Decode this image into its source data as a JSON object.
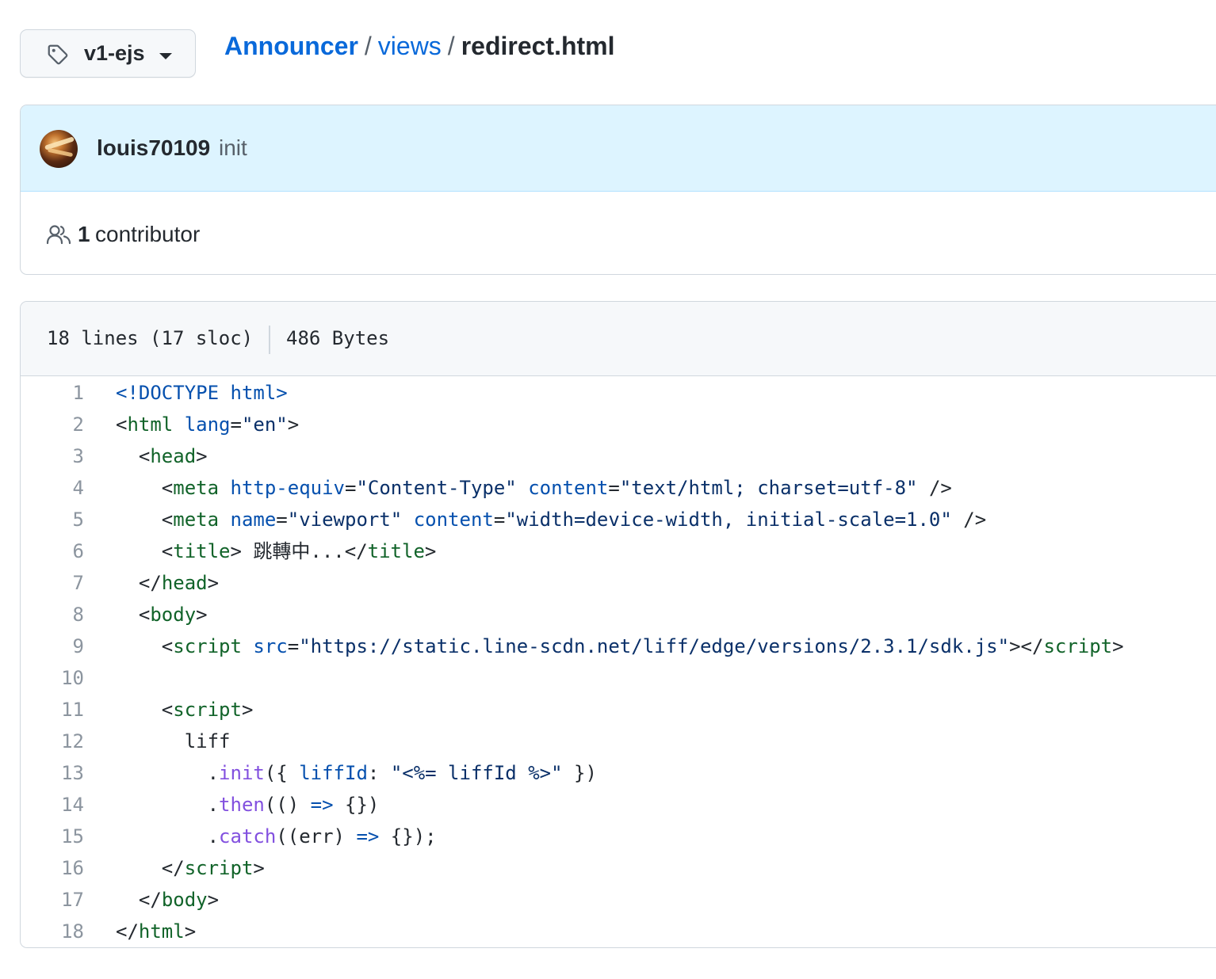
{
  "branch": {
    "name": "v1-ejs"
  },
  "breadcrumb": {
    "repo": "Announcer",
    "sep1": "/",
    "folder": "views",
    "sep2": "/",
    "file": "redirect.html"
  },
  "commit": {
    "author": "louis70109",
    "message": "init"
  },
  "contributors": {
    "count": "1",
    "label": "contributor"
  },
  "file_info": {
    "lines": "18 lines (17 sloc)",
    "size": "486 Bytes"
  },
  "code_lines": [
    {
      "num": "1"
    },
    {
      "num": "2"
    },
    {
      "num": "3"
    },
    {
      "num": "4"
    },
    {
      "num": "5"
    },
    {
      "num": "6"
    },
    {
      "num": "7"
    },
    {
      "num": "8"
    },
    {
      "num": "9"
    },
    {
      "num": "10"
    },
    {
      "num": "11"
    },
    {
      "num": "12"
    },
    {
      "num": "13"
    },
    {
      "num": "14"
    },
    {
      "num": "15"
    },
    {
      "num": "16"
    },
    {
      "num": "17"
    },
    {
      "num": "18"
    }
  ],
  "code": {
    "l1": {
      "doctype": "<!DOCTYPE html>"
    },
    "l2": {
      "open": "<",
      "tag": "html",
      "sp": " ",
      "attr": "lang",
      "eq": "=",
      "val": "\"en\"",
      "close": ">"
    },
    "l3": {
      "indent": "  ",
      "open": "<",
      "tag": "head",
      "close": ">"
    },
    "l4": {
      "indent": "    ",
      "open": "<",
      "tag": "meta",
      "sp1": " ",
      "attr1": "http-equiv",
      "eq1": "=",
      "val1": "\"Content-Type\"",
      "sp2": " ",
      "attr2": "content",
      "eq2": "=",
      "val2": "\"text/html; charset=utf-8\"",
      "end": " />"
    },
    "l5": {
      "indent": "    ",
      "open": "<",
      "tag": "meta",
      "sp1": " ",
      "attr1": "name",
      "eq1": "=",
      "val1": "\"viewport\"",
      "sp2": " ",
      "attr2": "content",
      "eq2": "=",
      "val2": "\"width=device-width, initial-scale=1.0\"",
      "end": " />"
    },
    "l6": {
      "indent": "    ",
      "open": "<",
      "tag": "title",
      "close": ">",
      "text": " 跳轉中...",
      "open2": "</",
      "tag2": "title",
      "close2": ">"
    },
    "l7": {
      "indent": "  ",
      "open": "</",
      "tag": "head",
      "close": ">"
    },
    "l8": {
      "indent": "  ",
      "open": "<",
      "tag": "body",
      "close": ">"
    },
    "l9": {
      "indent": "    ",
      "open": "<",
      "tag": "script",
      "sp": " ",
      "attr": "src",
      "eq": "=",
      "val": "\"https://static.line-scdn.net/liff/edge/versions/2.3.1/sdk.js\"",
      "mid": "></",
      "tag2": "script",
      "close": ">"
    },
    "l10": {
      "text": ""
    },
    "l11": {
      "indent": "    ",
      "open": "<",
      "tag": "script",
      "close": ">"
    },
    "l12": {
      "text": "      liff"
    },
    "l13": {
      "indent": "        .",
      "fn": "init",
      "p1": "({ ",
      "key": "liffId",
      "colon": ": ",
      "val": "\"<%= liffId %>\"",
      "p2": " })"
    },
    "l14": {
      "indent": "        .",
      "fn": "then",
      "p1": "(() ",
      "arrow": "=>",
      "p2": " {})"
    },
    "l15": {
      "indent": "        .",
      "fn": "catch",
      "p1": "((err) ",
      "arrow": "=>",
      "p2": " {});"
    },
    "l16": {
      "indent": "    ",
      "open": "</",
      "tag": "script",
      "close": ">"
    },
    "l17": {
      "indent": "  ",
      "open": "</",
      "tag": "body",
      "close": ">"
    },
    "l18": {
      "open": "</",
      "tag": "html",
      "close": ">"
    }
  },
  "colors": {
    "link": "#0969da",
    "tag": "#116329",
    "attr": "#0550ae",
    "string": "#0a3069",
    "function": "#8250df",
    "commit_bg": "#ddf4ff"
  },
  "icons": {
    "branch": "tag-icon",
    "dropdown": "caret-down-icon",
    "contributors": "people-icon"
  }
}
